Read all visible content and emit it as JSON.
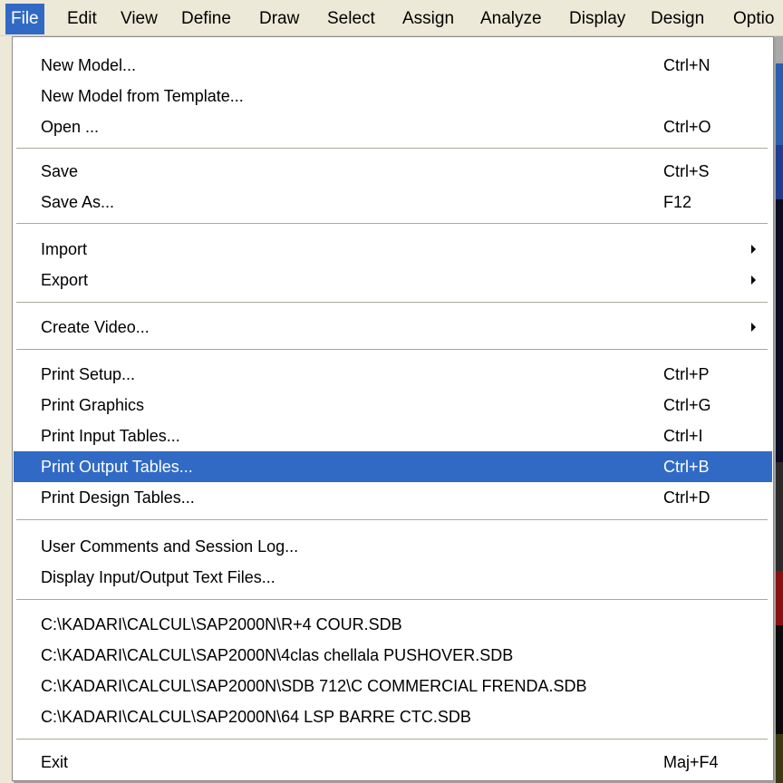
{
  "menubar": [
    "File",
    "Edit",
    "View",
    "Define",
    "Draw",
    "Select",
    "Assign",
    "Analyze",
    "Display",
    "Design",
    "Optio"
  ],
  "menu": {
    "new_model": {
      "label": "New Model...",
      "shortcut": "Ctrl+N"
    },
    "new_from_template": {
      "label": "New Model from Template..."
    },
    "open": {
      "label": "Open ...",
      "shortcut": "Ctrl+O"
    },
    "save": {
      "label": "Save",
      "shortcut": "Ctrl+S"
    },
    "save_as": {
      "label": "Save As...",
      "shortcut": "F12"
    },
    "import": {
      "label": "Import"
    },
    "export": {
      "label": "Export"
    },
    "create_video": {
      "label": "Create Video..."
    },
    "print_setup": {
      "label": "Print Setup...",
      "shortcut": "Ctrl+P"
    },
    "print_graphics": {
      "label": "Print Graphics",
      "shortcut": "Ctrl+G"
    },
    "print_input": {
      "label": "Print Input Tables...",
      "shortcut": "Ctrl+I"
    },
    "print_output": {
      "label": "Print Output Tables...",
      "shortcut": "Ctrl+B"
    },
    "print_design": {
      "label": "Print Design Tables...",
      "shortcut": "Ctrl+D"
    },
    "user_comments": {
      "label": "User Comments and Session Log..."
    },
    "display_io": {
      "label": "Display Input/Output Text Files..."
    },
    "recent": [
      "C:\\KADARI\\CALCUL\\SAP2000N\\R+4 COUR.SDB",
      "C:\\KADARI\\CALCUL\\SAP2000N\\4clas chellala PUSHOVER.SDB",
      "C:\\KADARI\\CALCUL\\SAP2000N\\SDB 712\\C COMMERCIAL FRENDA.SDB",
      "C:\\KADARI\\CALCUL\\SAP2000N\\64 LSP BARRE CTC.SDB"
    ],
    "exit": {
      "label": "Exit",
      "shortcut": "Maj+F4"
    }
  },
  "colors": {
    "highlight": "#316ac5",
    "menubar_bg": "#ece9d8",
    "menu_bg": "#ffffff"
  }
}
